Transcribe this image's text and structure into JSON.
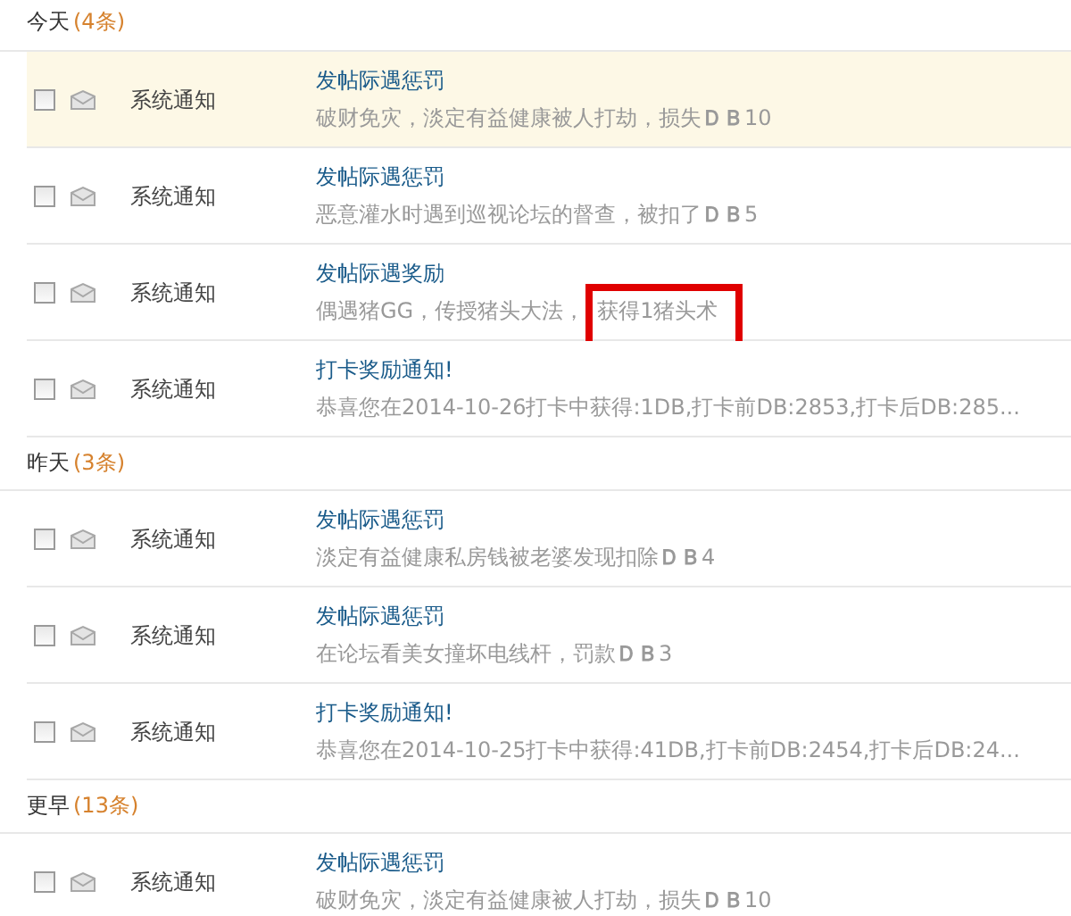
{
  "groups": [
    {
      "label": "今天",
      "count": "(4条)",
      "items": [
        {
          "checked": false,
          "highlighted": true,
          "sender": "系统通知",
          "title": "发帖际遇惩罚",
          "summary": "破财免灾，淡定有益健康被人打劫，损失**ＤＢ**10"
        },
        {
          "checked": false,
          "highlighted": false,
          "sender": "系统通知",
          "title": "发帖际遇惩罚",
          "summary": "恶意灌水时遇到巡视论坛的督查，被扣了**ＤＢ**5"
        },
        {
          "checked": false,
          "highlighted": false,
          "sender": "系统通知",
          "title": "发帖际遇奖励",
          "summary": "偶遇猪GG，传授猪头大法，",
          "boxed_text": "获得1猪头术"
        },
        {
          "checked": false,
          "highlighted": false,
          "sender": "系统通知",
          "title": "打卡奖励通知!",
          "summary": "恭喜您在2014-10-26打卡中获得:1DB,打卡前DB:2853,打卡后DB:285..."
        }
      ]
    },
    {
      "label": "昨天",
      "count": "(3条)",
      "items": [
        {
          "checked": false,
          "highlighted": false,
          "sender": "系统通知",
          "title": "发帖际遇惩罚",
          "summary": "淡定有益健康私房钱被老婆发现扣除**ＤＢ**4"
        },
        {
          "checked": false,
          "highlighted": false,
          "sender": "系统通知",
          "title": "发帖际遇惩罚",
          "summary": "在论坛看美女撞坏电线杆，罚款**ＤＢ**3"
        },
        {
          "checked": false,
          "highlighted": false,
          "sender": "系统通知",
          "title": "打卡奖励通知!",
          "summary": "恭喜您在2014-10-25打卡中获得:41DB,打卡前DB:2454,打卡后DB:24..."
        }
      ]
    },
    {
      "label": "更早",
      "count": "(13条)",
      "items": [
        {
          "checked": false,
          "highlighted": false,
          "sender": "系统通知",
          "title": "发帖际遇惩罚",
          "summary": "破财免灾，淡定有益健康被人打劫，损失**ＤＢ**10"
        }
      ]
    }
  ]
}
